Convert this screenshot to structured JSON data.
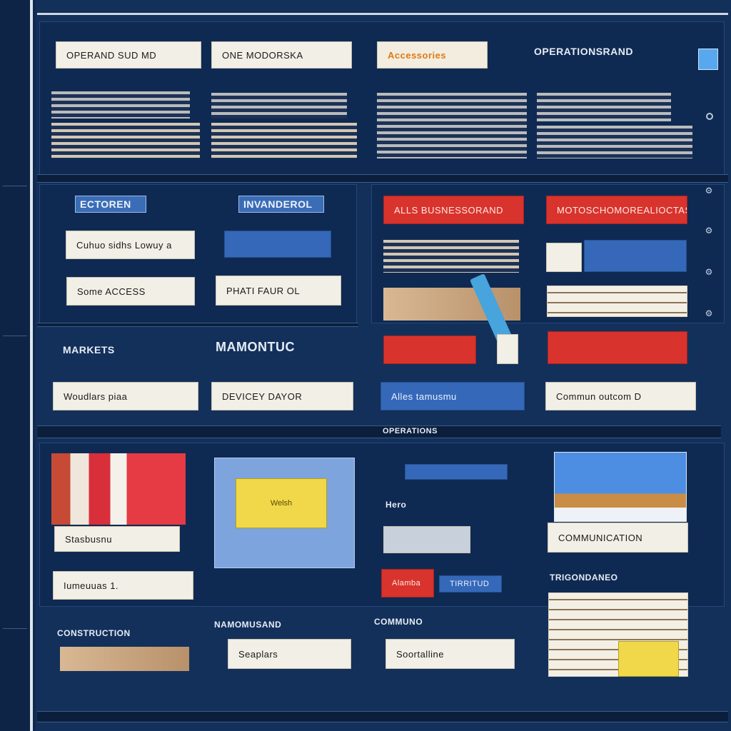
{
  "labels": {
    "r1_a": "OPERAND SUD MD",
    "r1_b": "ONE   MODORSKA",
    "r1_c": "Accessories",
    "r1_title": "OPERATIONSRAND",
    "h_left": "ECTOREN",
    "h_mid": "INVANDEROL",
    "red_1": "ALLS BUSNESSORAND",
    "red_2": "MOTOSCHOMOREALIOCTAS",
    "l_a1": "Cuhuo sidhs  Lowuy a",
    "l_b1": "Some  ACCESS",
    "l_b2": "PHATI FAUR OL",
    "h2_left": "MARKETS",
    "h2_mid": "MAMONTUC",
    "l_c1": "Woudlars piaa",
    "l_c2": "DEVICEY DAYOR",
    "blue_c3": "Alles tamusmu",
    "l_c4": "Commun outcom  D",
    "divider_text": "OPERATIONS",
    "lower_1": "Stasbusnu",
    "lower_2": "Iumeuuas  1.",
    "card_yellow": "Welsh",
    "blue_stub": "Hero",
    "red_tag": "Alamba",
    "blue_tag": "TIRRITUD",
    "right_doc": "COMMUNICATION",
    "right_head": "TRIGONDANEO",
    "bottom_h1": "CONSTRUCTION",
    "bottom_h2": "NAMOMUSAND",
    "bottom_h3": "COMMUNO",
    "b_1": "Seaplars",
    "b_2": "Soortalline"
  },
  "icons": {
    "side_1": "circle-icon",
    "side_2": "gear-icon",
    "yellow": "note-icon"
  },
  "colors": {
    "board": "#13305b",
    "label_red": "#d8332c",
    "label_blue": "#3568b8",
    "label_cream": "#f2efe6"
  }
}
